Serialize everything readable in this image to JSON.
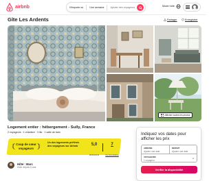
{
  "header": {
    "logo_text": "airbnb",
    "search": {
      "location": "N'importe où",
      "week": "Une semaine",
      "guests": "Ajouter des voyageurs"
    },
    "host_link": "Mode hôte",
    "icons": {
      "search": "search-icon",
      "globe": "globe-icon",
      "menu": "menu-icon",
      "avatar": "user-avatar-icon"
    }
  },
  "listing": {
    "title": "Gîte Les Ardents",
    "share_label": "Partager",
    "save_label": "Enregistrer",
    "show_all_photos": "Afficher toutes les photos",
    "subtitle": "Logement entier : hébergement - Sully, France",
    "details": "2 voyageurs · 1 chambre · 3 lits · 1 salle de bain"
  },
  "highlight": {
    "badge": "Coup de cœur voyageurs",
    "description": "Un des logements préférés des voyageurs sur Airbnb",
    "rating": "5,0",
    "stars": "★★★★★",
    "reviews_count": "7",
    "reviews_label": "Commentaires"
  },
  "host": {
    "name": "Hôte : Marc",
    "since": "Hôte depuis 6 ans"
  },
  "booking": {
    "title": "Indiquez vos dates pour afficher les prix",
    "arrival_label": "ARRIVÉE",
    "arrival_value": "Ajouter une date",
    "departure_label": "DÉPART",
    "departure_value": "Ajouter une date",
    "guests_label": "VOYAGEURS",
    "guests_value": "1 voyageur",
    "cta": "Vérifier la disponibilité"
  },
  "colors": {
    "brand": "#ff385c",
    "highlight": "#f2e41a",
    "cta": "#e61e4d"
  }
}
